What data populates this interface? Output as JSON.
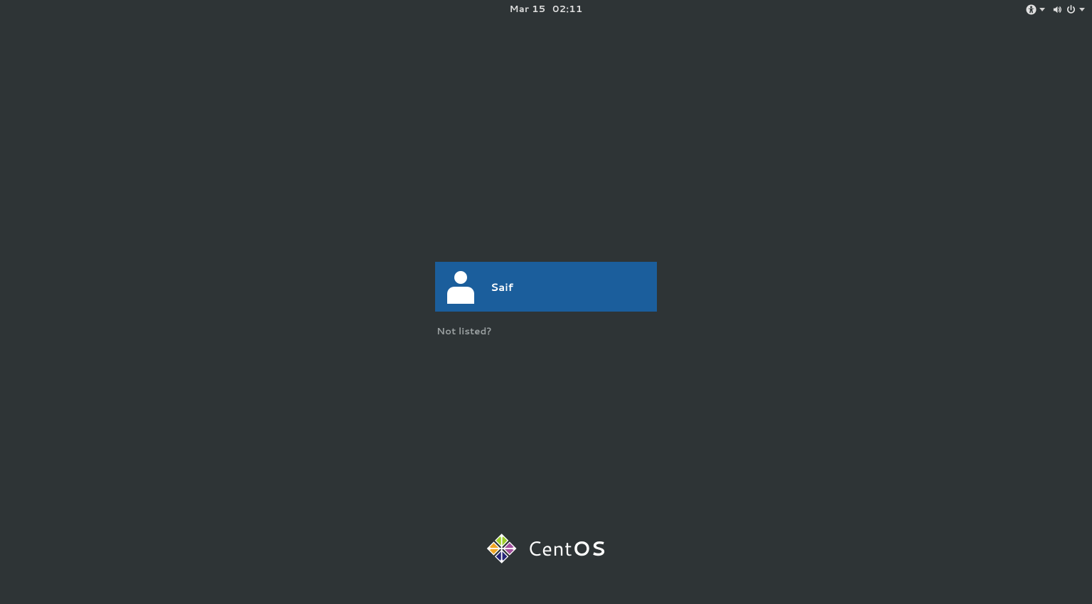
{
  "topbar": {
    "date": "Mar 15",
    "time": "02:11"
  },
  "status": {
    "accessibility_icon": "accessibility",
    "volume_icon": "volume",
    "power_icon": "power"
  },
  "login": {
    "users": [
      {
        "name": "Saif"
      }
    ],
    "not_listed_label": "Not listed?"
  },
  "branding": {
    "name_prefix": "Cent",
    "name_suffix": "OS"
  }
}
